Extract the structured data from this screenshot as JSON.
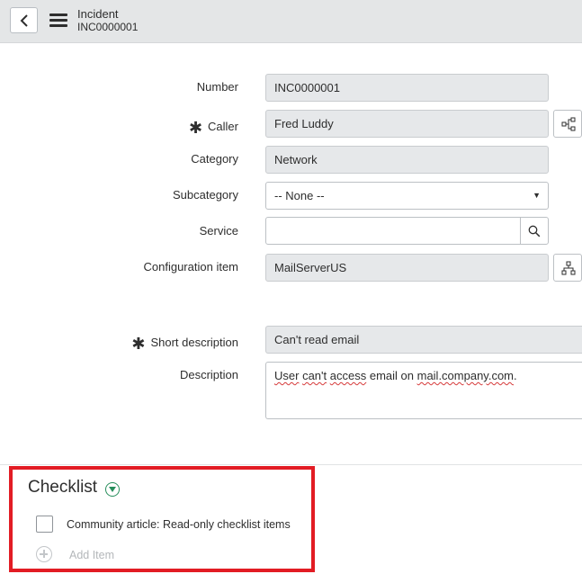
{
  "header": {
    "title": "Incident",
    "subtitle": "INC0000001"
  },
  "form": {
    "number": {
      "label": "Number",
      "value": "INC0000001"
    },
    "caller": {
      "label": "Caller",
      "value": "Fred Luddy",
      "required": true
    },
    "category": {
      "label": "Category",
      "value": "Network"
    },
    "subcategory": {
      "label": "Subcategory",
      "value": "-- None --"
    },
    "service": {
      "label": "Service",
      "value": ""
    },
    "configuration_item": {
      "label": "Configuration item",
      "value": "MailServerUS"
    },
    "short_description": {
      "label": "Short description",
      "value": "Can't read email",
      "required": true
    },
    "description": {
      "label": "Description",
      "value_parts": [
        "User",
        " ",
        "can't",
        " ",
        "access",
        " email on ",
        "mail.company.com",
        "."
      ]
    }
  },
  "checklist": {
    "title": "Checklist",
    "items": [
      {
        "label": "Community article: Read-only checklist items",
        "checked": false
      }
    ],
    "add_placeholder": "Add Item"
  },
  "colors": {
    "highlight_border": "#e21c24",
    "toggle_green": "#278e5c",
    "readonly_bg": "#e6e8ea"
  }
}
